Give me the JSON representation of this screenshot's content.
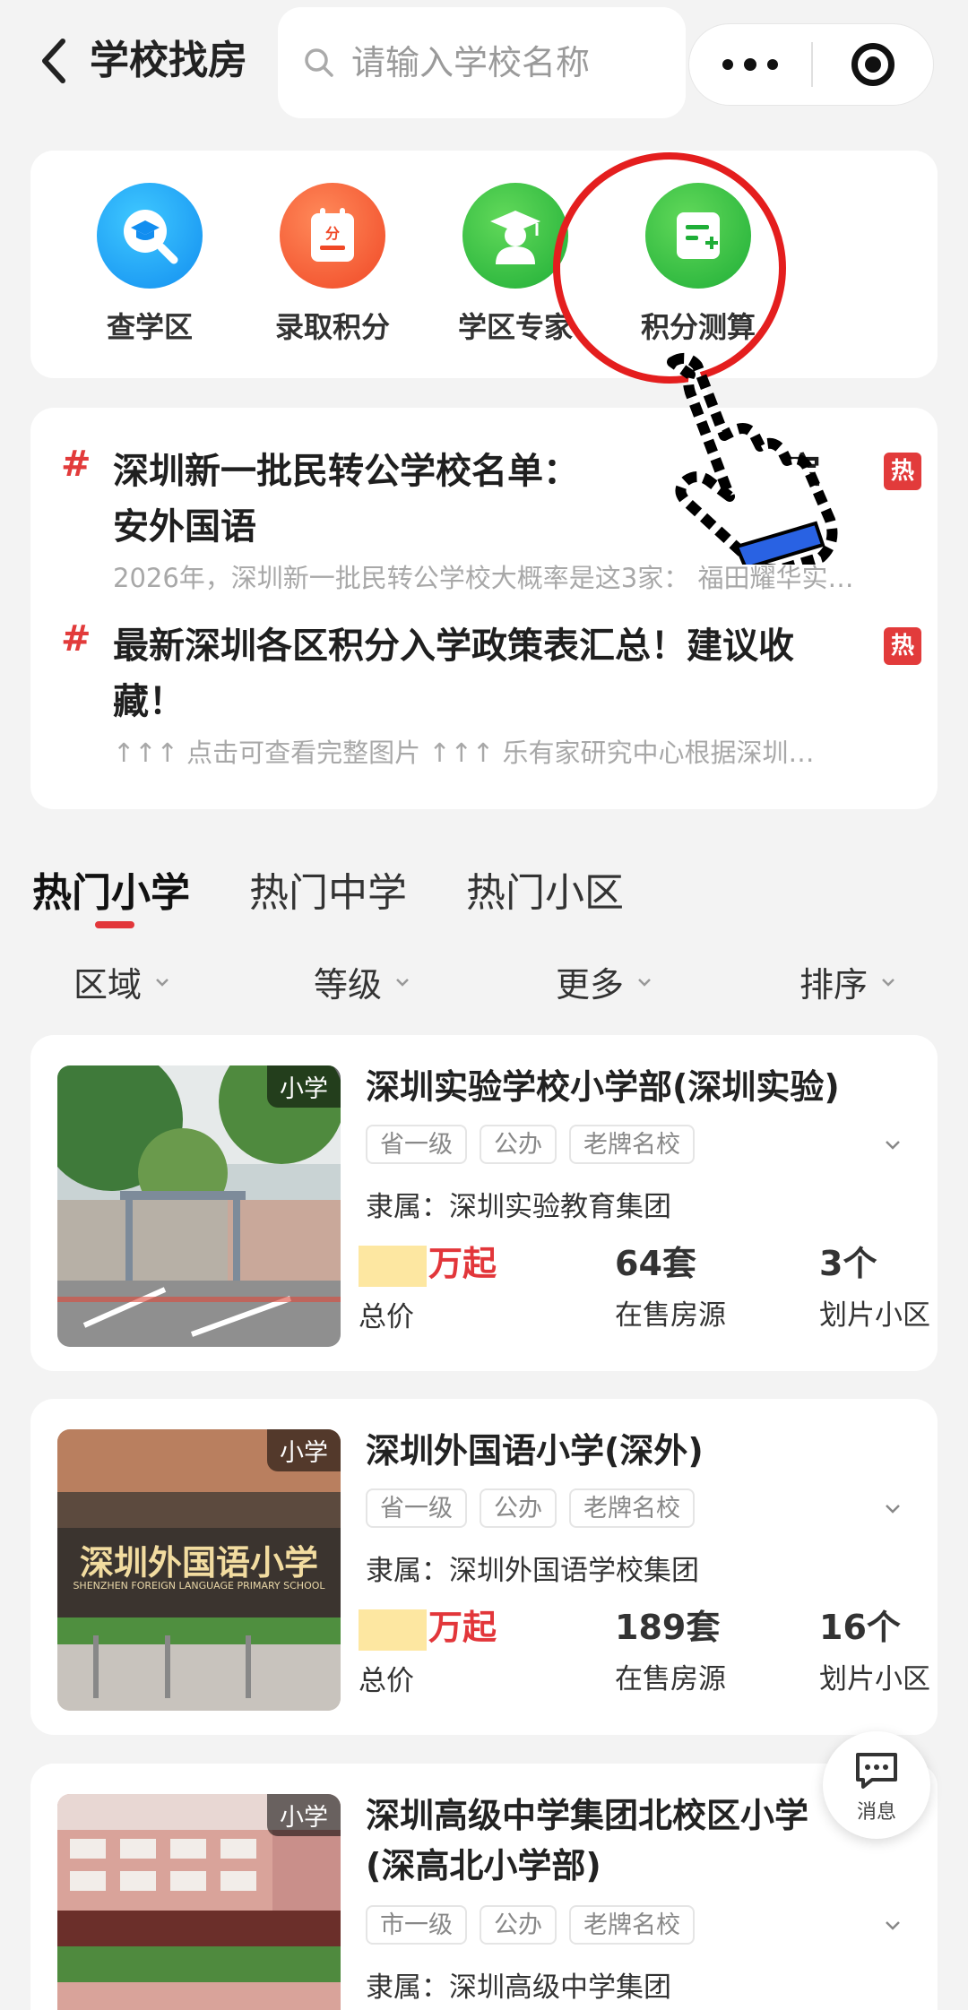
{
  "header": {
    "title": "学校找房",
    "search_placeholder": "请输入学校名称"
  },
  "quick_entries": [
    {
      "label": "查学区",
      "icon": "school-search-icon",
      "color": "#1a9cf5"
    },
    {
      "label": "录取积分",
      "icon": "score-calendar-icon",
      "color": "#f15a32"
    },
    {
      "label": "学区专家",
      "icon": "graduate-expert-icon",
      "color": "#2bb843"
    },
    {
      "label": "积分测算",
      "icon": "calculator-doc-icon",
      "color": "#2bb843"
    }
  ],
  "news": [
    {
      "title": "深圳新一批民转公学校名单：福田耀华实验、宝安外国语",
      "title_visible": "深圳新一批民转公学校名单：",
      "title_tail": "宝",
      "title_line2": "安外国语",
      "subtitle": "2026年，深圳新一批民转公学校大概率是这3家：  福田耀华实…",
      "badge": "热"
    },
    {
      "title_line1": "最新深圳各区积分入学政策表汇总！建议收",
      "title_line2": "藏！",
      "subtitle": "↑↑↑ 点击可查看完整图片 ↑↑↑ 乐有家研究中心根据深圳…",
      "badge": "热"
    }
  ],
  "tabs": [
    "热门小学",
    "热门中学",
    "热门小区"
  ],
  "filters": [
    "区域",
    "等级",
    "更多",
    "排序"
  ],
  "schools": [
    {
      "badge": "小学",
      "name": "深圳实验学校小学部(深圳实验)",
      "tags": [
        "省一级",
        "公办",
        "老牌名校"
      ],
      "affiliation": "隶属：深圳实验教育集团",
      "price_unit": "万起",
      "price_label": "总价",
      "listings": "64套",
      "listings_label": "在售房源",
      "communities": "3个",
      "communities_label": "划片小区"
    },
    {
      "badge": "小学",
      "name": "深圳外国语小学(深外)",
      "tags": [
        "省一级",
        "公办",
        "老牌名校"
      ],
      "affiliation": "隶属：深圳外国语学校集团",
      "price_unit": "万起",
      "price_label": "总价",
      "listings": "189套",
      "listings_label": "在售房源",
      "communities": "16个",
      "communities_label": "划片小区",
      "photo_sign": "深圳外国语小学",
      "photo_sign_en": "SHENZHEN FOREIGN LANGUAGE PRIMARY SCHOOL"
    },
    {
      "badge": "小学",
      "name_line1": "深圳高级中学集团北校区小学",
      "name_line2": "(深高北小学部)",
      "tags": [
        "市一级",
        "公办",
        "老牌名校"
      ],
      "affiliation": "隶属：深圳高级中学集团"
    }
  ],
  "fab": {
    "label": "消息",
    "icon": "message-icon"
  },
  "colors": {
    "accent": "#e2363a",
    "price_mask": "#fde7a1",
    "highlight": "#e41e1e"
  }
}
